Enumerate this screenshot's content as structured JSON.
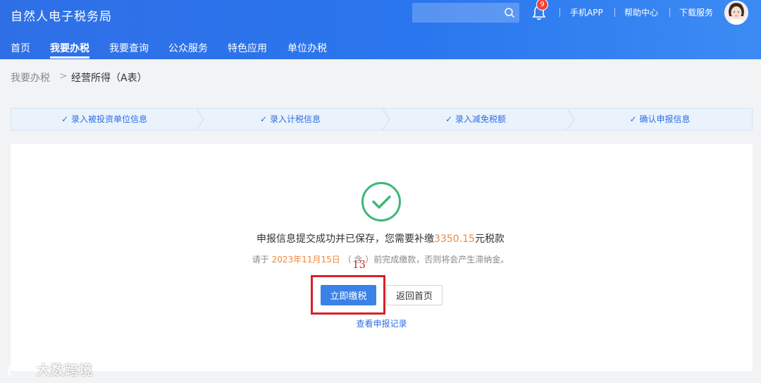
{
  "header": {
    "brand": "自然人电子税务局",
    "search_placeholder": "",
    "notification_count": "9",
    "links": [
      "手机APP",
      "帮助中心",
      "下载服务"
    ]
  },
  "nav": {
    "items": [
      "首页",
      "我要办税",
      "我要查询",
      "公众服务",
      "特色应用",
      "单位办税"
    ],
    "active": "我要办税"
  },
  "breadcrumb": {
    "root": "我要办税",
    "separator": ">",
    "current": "经营所得（A表）"
  },
  "steps": [
    "录入被投资单位信息",
    "录入计税信息",
    "录入减免税额",
    "确认申报信息"
  ],
  "result": {
    "message_prefix": "申报信息提交成功并已保存，您需要补缴",
    "amount": "3350.15",
    "message_suffix": "元税款",
    "deadline_prefix": "请于",
    "deadline_date": "2023年11月15日",
    "deadline_suffix": "（ 含 ）前完成缴款，否则将会产生滞纳金。"
  },
  "annotation": "13",
  "buttons": {
    "pay_now": "立即缴税",
    "back_home": "返回首页",
    "view_records": "查看申报记录"
  },
  "watermark": "大数跨境",
  "colors": {
    "header_blue": "#2f6fe6",
    "accent_orange": "#f0883a",
    "success_green": "#3cb878",
    "highlight_red": "#d8202a"
  }
}
